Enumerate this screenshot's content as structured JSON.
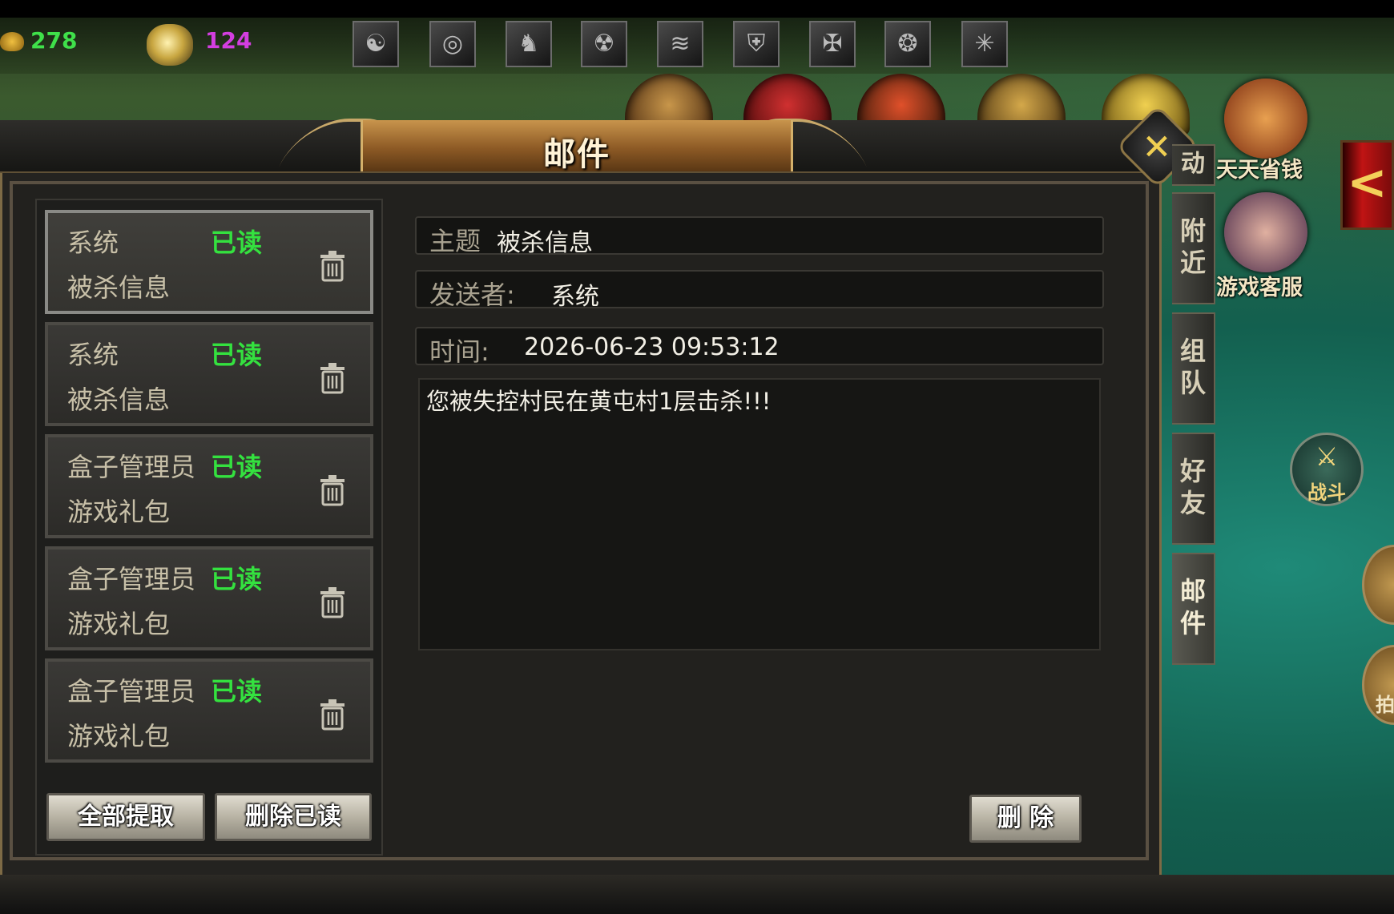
{
  "resources": {
    "gold": "278",
    "ingot": "124"
  },
  "skill_icons": [
    "swirl-icon",
    "vortex-icon",
    "beast-icon",
    "dragon-icon",
    "wing-icon",
    "shield-icon",
    "rune-icon",
    "spirit-icon",
    "web-icon"
  ],
  "window": {
    "title": "邮件",
    "close_glyph": "✕"
  },
  "mail_list": [
    {
      "sender": "系统",
      "status": "已读",
      "subject": "被杀信息"
    },
    {
      "sender": "系统",
      "status": "已读",
      "subject": "被杀信息"
    },
    {
      "sender": "盒子管理员",
      "status": "已读",
      "subject": "游戏礼包"
    },
    {
      "sender": "盒子管理员",
      "status": "已读",
      "subject": "游戏礼包"
    },
    {
      "sender": "盒子管理员",
      "status": "已读",
      "subject": "游戏礼包"
    }
  ],
  "list_buttons": {
    "collect_all": "全部提取",
    "delete_read": "删除已读"
  },
  "detail": {
    "subject_label": "主题",
    "subject_value": "被杀信息",
    "sender_label": "发送者:",
    "sender_value": "系统",
    "time_label": "时间:",
    "time_value": "2026-06-23 09:53:12",
    "content": "您被失控村民在黄屯村1层击杀!!!",
    "delete_button": "删 除"
  },
  "side_tabs": {
    "partial": "动",
    "nearby": "附近",
    "team": "组队",
    "friends": "好友",
    "mail": "邮件"
  },
  "right_widgets": {
    "daily_saving": "天天省钱",
    "customer_service": "游戏客服",
    "fight": "战斗",
    "collapse_glyph": "<",
    "edge_label": "拍"
  }
}
